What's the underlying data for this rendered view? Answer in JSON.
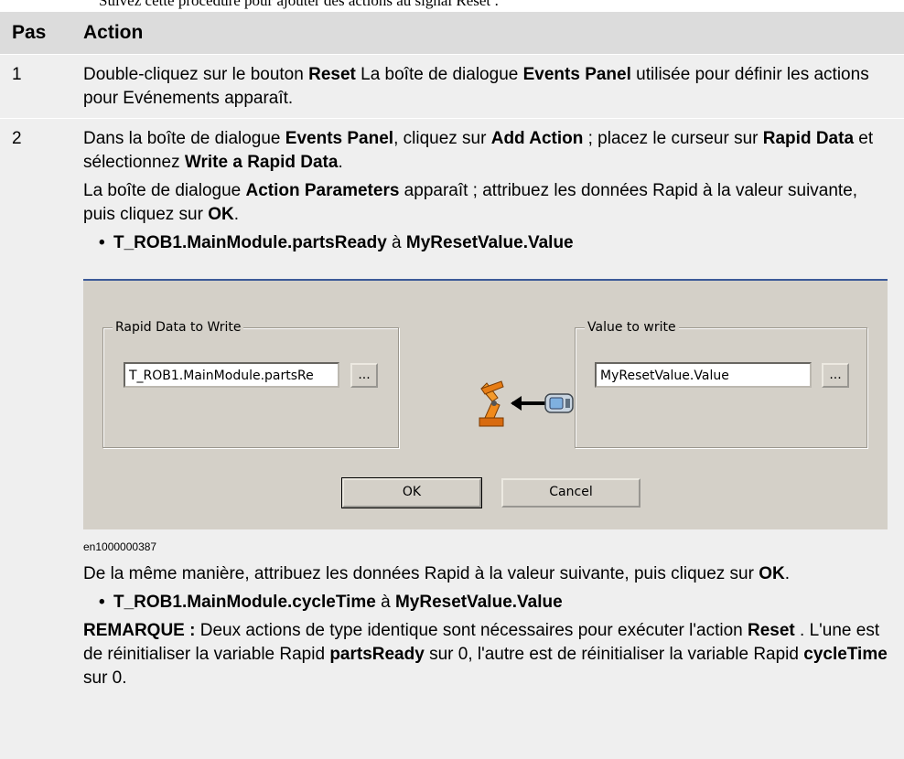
{
  "top_text": "Suivez cette procédure pour ajouter des actions au signal Reset :",
  "table": {
    "col_step": "Pas",
    "col_action": "Action",
    "row1": {
      "num": "1",
      "t1": "Double-cliquez sur le bouton ",
      "b1": "Reset",
      "t2": " La boîte de dialogue ",
      "b2": "Events Panel",
      "t3": " utilisée pour définir les actions pour Evénements apparaît."
    },
    "row2": {
      "num": "2",
      "p1": {
        "t1": "Dans la boîte de dialogue ",
        "b1": "Events Panel",
        "t2": ", cliquez sur ",
        "b2": "Add Action",
        "t3": " ; placez le curseur sur ",
        "b3": "Rapid Data",
        "t4": " et sélectionnez ",
        "b4": "Write a Rapid Data",
        "t5": "."
      },
      "p2": {
        "t1": "La boîte de dialogue ",
        "b1": "Action Parameters",
        "t2": " apparaît ; attribuez les données Rapid à la valeur suivante, puis cliquez sur ",
        "b2": "OK",
        "t3": "."
      },
      "bullet1": {
        "a": "T_ROB1.MainModule.partsReady",
        "mid": " à ",
        "b": "MyResetValue.Value"
      },
      "dialog": {
        "group_left_label": "Rapid Data to Write",
        "rapid_data_value": "T_ROB1.MainModule.partsRe",
        "browse_label": "...",
        "group_right_label": "Value to write",
        "value_field": "MyResetValue.Value",
        "ok_label": "OK",
        "cancel_label": "Cancel"
      },
      "caption": "en1000000387",
      "p3": {
        "t1": "De la même manière, attribuez les données Rapid à la valeur suivante, puis cliquez sur ",
        "b1": "OK",
        "t2": "."
      },
      "bullet2": {
        "a": "T_ROB1.MainModule.cycleTime",
        "mid": " à ",
        "b": "MyResetValue.Value"
      },
      "note": {
        "label": "REMARQUE :",
        "t1": " Deux actions de type identique sont nécessaires pour exécuter l'action ",
        "b1": "Reset",
        "t2": " . L'une est de réinitialiser la variable Rapid ",
        "b2": "partsReady",
        "t3": " sur 0, l'autre est de réinitialiser la variable Rapid ",
        "b3": "cycleTime",
        "t4": " sur 0."
      }
    }
  }
}
